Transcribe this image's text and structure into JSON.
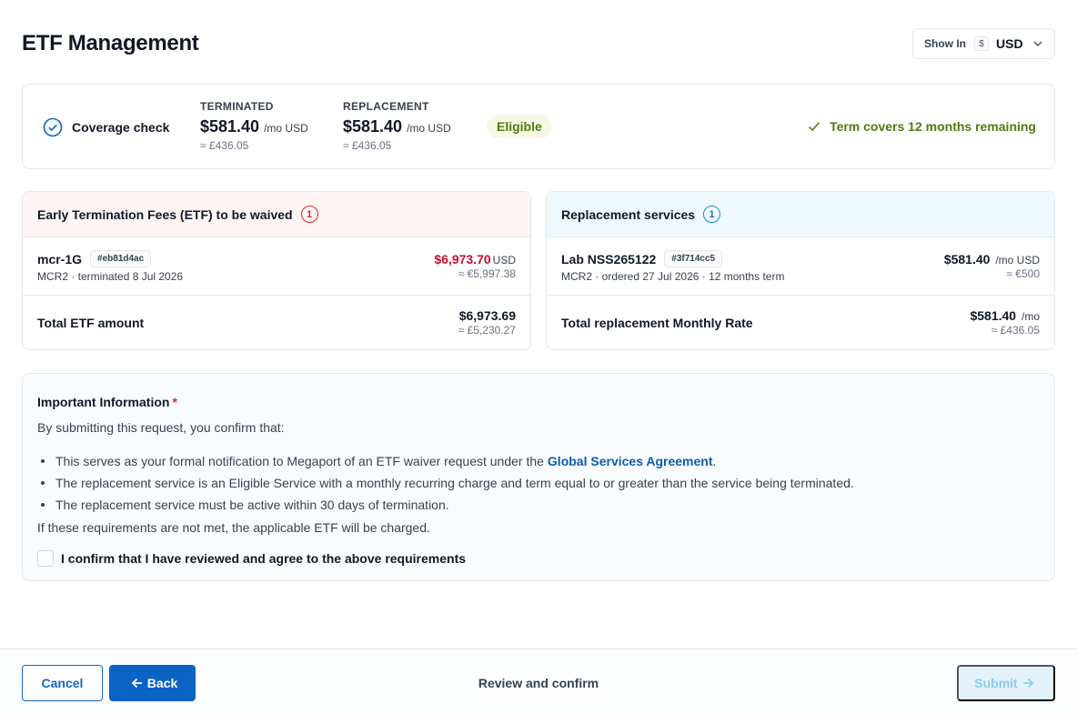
{
  "header": {
    "title": "ETF Management",
    "show_in_label": "Show In",
    "currency_symbol": "$",
    "currency": "USD"
  },
  "coverage": {
    "label": "Coverage check",
    "terminated": {
      "label": "TERMINATED",
      "amount": "$581.40",
      "unit": "/mo USD",
      "approx": "≈ £436.05"
    },
    "replacement": {
      "label": "REPLACEMENT",
      "amount": "$581.40",
      "unit": "/mo USD",
      "approx": "≈ £436.05"
    },
    "status": "Eligible",
    "term_note": "Term covers 12 months remaining"
  },
  "etf_panel": {
    "title": "Early Termination Fees (ETF) to be waived",
    "count": "1",
    "service": {
      "name": "mcr-1G",
      "id": "#eb81d4ac",
      "meta": "MCR2 · terminated 8 Jul 2026",
      "price": "$6,973.70",
      "price_unit": "USD",
      "approx": "≈ €5,997.38"
    },
    "total_label": "Total ETF amount",
    "total_amount": "$6,973.69",
    "total_approx": "≈ £5,230.27"
  },
  "rep_panel": {
    "title": "Replacement services",
    "count": "1",
    "service": {
      "name": "Lab NSS265122",
      "id": "#3f714cc5",
      "meta": "MCR2 · ordered 27 Jul 2026 · 12 months term",
      "price": "$581.40",
      "price_unit": "/mo USD",
      "approx": "≈ €500"
    },
    "total_label": "Total replacement Monthly Rate",
    "total_amount": "$581.40",
    "total_unit": "/mo",
    "total_approx": "≈ £436.05"
  },
  "info": {
    "title": "Important Information",
    "required_mark": "*",
    "intro": "By submitting this request, you confirm that:",
    "bullet1": "This serves as your formal notification to Megaport of an ETF waiver request under the",
    "bullet1_link": "Global Services Agreement",
    "bullet1_end": ".",
    "bullet2": "The replacement service is an Eligible Service with a monthly recurring charge and term equal to or greater than the service being terminated.",
    "bullet3": "The replacement service must be active within 30 days of termination.",
    "outro": "If these requirements are not met, the applicable ETF will be charged.",
    "confirm_label": "I confirm that I have reviewed and agree to the above requirements"
  },
  "footer": {
    "cancel": "Cancel",
    "back": "Back",
    "step": "Review and confirm",
    "submit": "Submit"
  },
  "colors": {
    "primary": "#0b63c4",
    "danger": "#c8102e",
    "success": "#4d7c0f"
  }
}
